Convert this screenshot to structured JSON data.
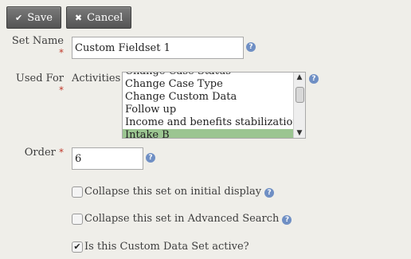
{
  "toolbar": {
    "save_label": "Save",
    "cancel_label": "Cancel",
    "save_icon": "checkmark-icon",
    "cancel_icon": "x-icon"
  },
  "form": {
    "set_name": {
      "label": "Set Name",
      "required_marker": "*",
      "value": "Custom Fieldset 1",
      "help": "?"
    },
    "used_for": {
      "label": "Used For",
      "required_marker": "*",
      "entity": "Activities",
      "options": [
        "Change Case Status",
        "Change Case Type",
        "Change Custom Data",
        "Follow up",
        "Income and benefits stabilization",
        "Intake B"
      ],
      "selected": "Intake B",
      "help": "?"
    },
    "order": {
      "label": "Order",
      "required_marker": "*",
      "value": "6",
      "help": "?"
    },
    "checkboxes": [
      {
        "label": "Collapse this set on initial display",
        "checked": false,
        "has_help": true
      },
      {
        "label": "Collapse this set in Advanced Search",
        "checked": false,
        "has_help": true
      },
      {
        "label": "Is this Custom Data Set active?",
        "checked": true,
        "has_help": false
      }
    ]
  },
  "colors": {
    "panel_bg": "#efeee9",
    "button_bg": "#626262",
    "selected_option_bg": "#9bc591",
    "required_marker": "#c0392b",
    "help_icon": "#6f8fc4"
  }
}
